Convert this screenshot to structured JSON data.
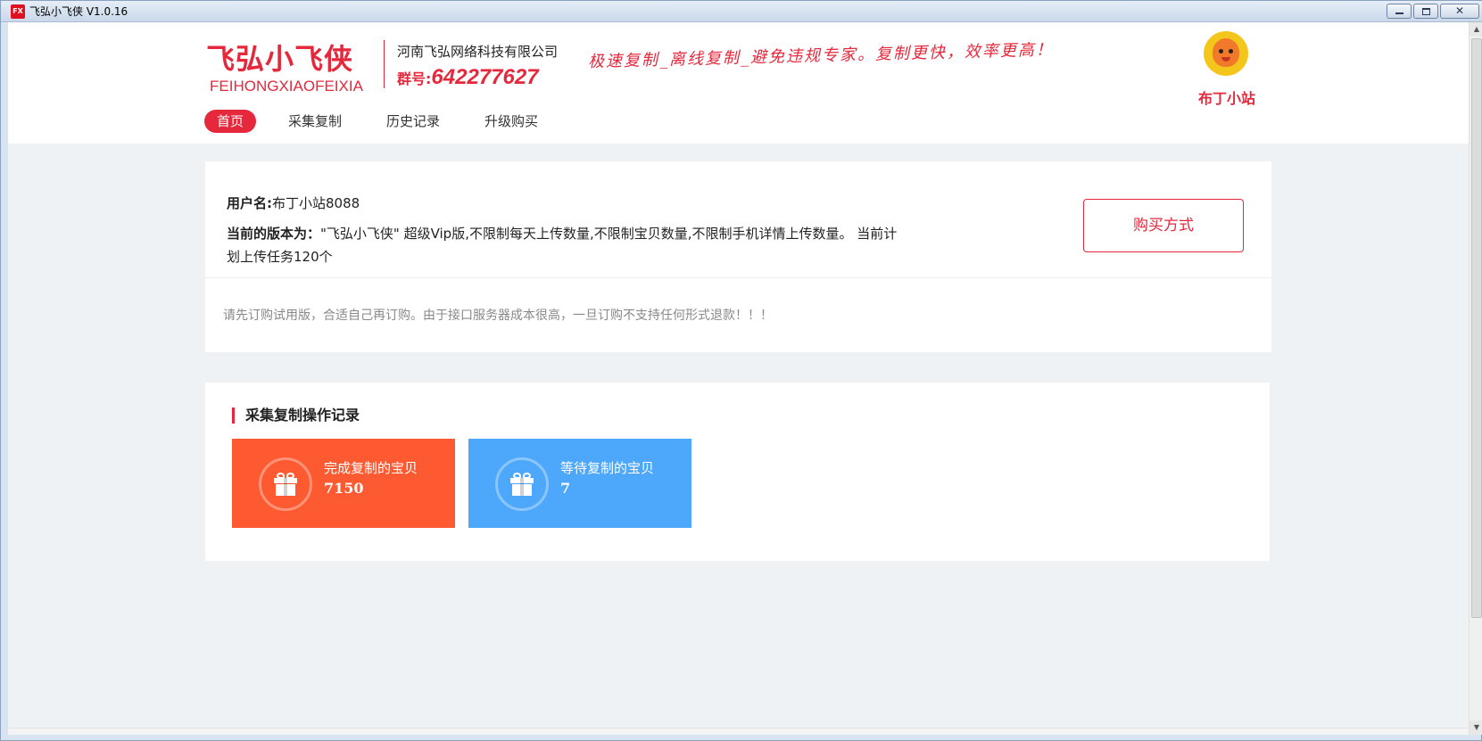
{
  "window": {
    "title": "飞弘小飞侠 V1.0.16",
    "icon_label": "FX",
    "controls": [
      "minimize-icon",
      "maximize-icon",
      "close-icon"
    ]
  },
  "brand": {
    "name_cn": "飞弘小飞侠",
    "name_en": "FEIHONGXIAOFEIXIA",
    "company": "河南飞弘网络科技有限公司",
    "group_label": "群号:",
    "group_number": "642277627",
    "slogan": "极速复制_离线复制_避免违规专家。复制更快，效率更高！",
    "color": "#e5283c"
  },
  "user_badge": {
    "name": "布丁小站",
    "avatar_icon": "mascot-avatar-icon"
  },
  "nav": {
    "items": [
      {
        "label": "首页",
        "active": true
      },
      {
        "label": "采集复制",
        "active": false
      },
      {
        "label": "历史记录",
        "active": false
      },
      {
        "label": "升级购买",
        "active": false
      }
    ]
  },
  "account": {
    "username_label": "用户名:",
    "username_value": "布丁小站8088",
    "version_label": "当前的版本为：",
    "version_text": "\"飞弘小飞侠\" 超级Vip版,不限制每天上传数量,不限制宝贝数量,不限制手机详情上传数量。 当前计划上传任务120个",
    "buy_button": "购买方式",
    "notice": "请先订购试用版，合适自己再订购。由于接口服务器成本很高，一旦订购不支持任何形式退款！！！"
  },
  "records": {
    "title": "采集复制操作记录",
    "tiles": [
      {
        "label": "完成复制的宝贝",
        "value": "7150",
        "color": "#fd5a31",
        "icon": "gift-icon"
      },
      {
        "label": "等待复制的宝贝",
        "value": "7",
        "color": "#4da7fa",
        "icon": "gift-icon"
      }
    ]
  }
}
